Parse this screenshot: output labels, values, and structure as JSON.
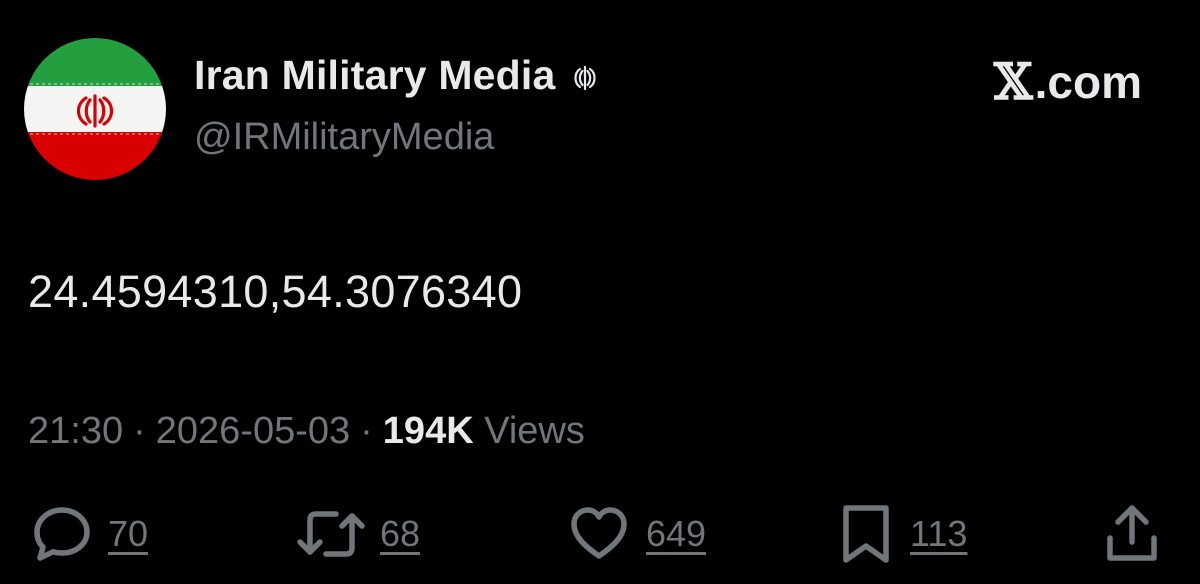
{
  "author": {
    "display_name": "Iran Military Media",
    "handle": "@IRMilitaryMedia",
    "avatar_icon": "iran-flag-icon",
    "badge_icon": "iran-emblem-icon"
  },
  "brand": {
    "mark": "𝕏",
    "suffix": ".com"
  },
  "tweet": {
    "text": "24.4594310,54.3076340",
    "time": "21:30",
    "separator": "·",
    "date": "2026-05-03",
    "views_count": "194K",
    "views_label": "Views"
  },
  "actions": {
    "replies": "70",
    "reposts": "68",
    "likes": "649",
    "bookmarks": "113"
  },
  "colors": {
    "background": "#000000",
    "primary_text": "#e7e9ea",
    "secondary_text": "#71767b",
    "flag_green": "#239f40",
    "flag_white": "#f4f4f2",
    "flag_red": "#da0000"
  }
}
